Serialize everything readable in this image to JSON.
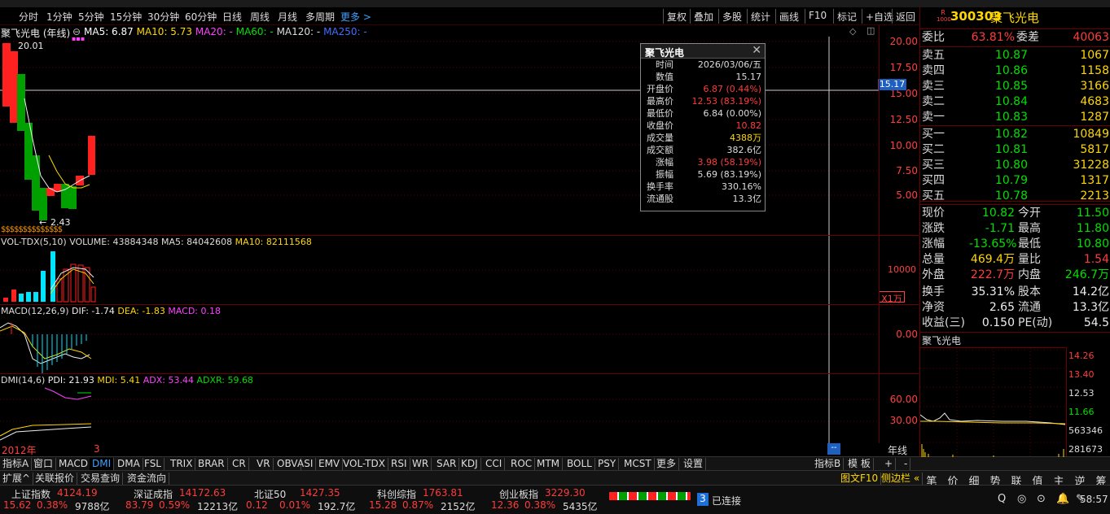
{
  "period_bar": {
    "items": [
      "分时",
      "1分钟",
      "5分钟",
      "15分钟",
      "30分钟",
      "60分钟",
      "日线",
      "周线",
      "月线",
      "多周期"
    ],
    "more": "更多 >",
    "tools": [
      "复权",
      "叠加",
      "多股",
      "统计",
      "画线",
      "F10",
      "标记",
      "+自选",
      "返回"
    ]
  },
  "main": {
    "stock_label": "聚飞光电 (年线)",
    "ma": [
      {
        "label": "MA5: 6.87",
        "color": "#ffffff"
      },
      {
        "label": "MA10: 5.73",
        "color": "#ffd700"
      },
      {
        "label": "MA20: -",
        "color": "#ff40ff"
      },
      {
        "label": "MA60: -",
        "color": "#00e000"
      },
      {
        "label": "MA120: -",
        "color": "#dddddd"
      },
      {
        "label": "MA250: -",
        "color": "#3f6fff"
      }
    ],
    "high_label": "20.01",
    "low_label": "2.43",
    "price_ticks": [
      "20.00",
      "17.50",
      "15.00",
      "12.50",
      "10.00",
      "7.50",
      "5.00"
    ],
    "cursor_value": "15.17"
  },
  "volume": {
    "label": "VOL-TDX(5,10)",
    "volume": "VOLUME: 43884348",
    "ma5": "MA5: 84042608",
    "ma10": "MA10: 82111568",
    "tick": "10000",
    "unit": "X1万"
  },
  "macd": {
    "label": "MACD(12,26,9)",
    "dif": "DIF: -1.74",
    "dea": "DEA: -1.83",
    "macd": "MACD: 0.18",
    "tick": "0.00"
  },
  "dmi": {
    "label": "DMI(14,6)",
    "pdi": "PDI: 21.93",
    "mdi": "MDI: 5.41",
    "adx": "ADX: 53.44",
    "adxr": "ADXR: 59.68",
    "ticks": [
      "60.00",
      "30.00"
    ]
  },
  "timeline": {
    "start": "2012年",
    "marker": "3",
    "period": "年线"
  },
  "tooltip": {
    "title": "聚飞光电",
    "rows": [
      {
        "k": "时间",
        "v": "2026/03/06/五",
        "c": "#dddddd"
      },
      {
        "k": "数值",
        "v": "15.17",
        "c": "#dddddd"
      },
      {
        "k": "开盘价",
        "v": "6.87 (0.44%)",
        "c": "#ff3c3c"
      },
      {
        "k": "最高价",
        "v": "12.53 (83.19%)",
        "c": "#ff3c3c"
      },
      {
        "k": "最低价",
        "v": "6.84 (0.00%)",
        "c": "#dddddd"
      },
      {
        "k": "收盘价",
        "v": "10.82",
        "c": "#ff3c3c"
      },
      {
        "k": "成交量",
        "v": "4388万",
        "c": "#ffd700"
      },
      {
        "k": "成交额",
        "v": "382.6亿",
        "c": "#dddddd"
      },
      {
        "k": "涨幅",
        "v": "3.98 (58.19%)",
        "c": "#ff3c3c"
      },
      {
        "k": "振幅",
        "v": "5.69 (83.19%)",
        "c": "#dddddd"
      },
      {
        "k": "换手率",
        "v": "330.16%",
        "c": "#dddddd"
      },
      {
        "k": "流通股",
        "v": "13.3亿",
        "c": "#dddddd"
      }
    ]
  },
  "indicator_tabs": [
    "指标A",
    "窗口",
    "MACD",
    "DMI",
    "DMA",
    "FSL",
    "TRIX",
    "BRAR",
    "CR",
    "VR",
    "OBV",
    "ASI",
    "EMV",
    "VOL-TDX",
    "RSI",
    "WR",
    "SAR",
    "KDJ",
    "CCI",
    "ROC",
    "MTM",
    "BOLL",
    "PSY",
    "MCST",
    "更多",
    "设置"
  ],
  "tabs_right": [
    "指标B",
    "模 板",
    "+",
    "-"
  ],
  "tabs2": [
    "扩展^",
    "关联报价",
    "交易查询",
    "资金流向"
  ],
  "tabs2_right": [
    "图文F10",
    "侧边栏 «"
  ],
  "side_nav": [
    "笔",
    "价",
    "细",
    "势",
    "联",
    "值",
    "主",
    "逆",
    "筹"
  ],
  "side": {
    "code": "300303",
    "name": "聚飞光电",
    "r_badge": "R",
    "num_badge": "1000",
    "weibi_k": "委比",
    "weibi_v": "63.81%",
    "weicha_k": "委差",
    "weicha_v": "40063",
    "sells": [
      {
        "k": "卖五",
        "p": "10.87",
        "v": "1067"
      },
      {
        "k": "卖四",
        "p": "10.86",
        "v": "1158"
      },
      {
        "k": "卖三",
        "p": "10.85",
        "v": "3166"
      },
      {
        "k": "卖二",
        "p": "10.84",
        "v": "4683"
      },
      {
        "k": "卖一",
        "p": "10.83",
        "v": "1287"
      }
    ],
    "buys": [
      {
        "k": "买一",
        "p": "10.82",
        "v": "10849"
      },
      {
        "k": "买二",
        "p": "10.81",
        "v": "5817"
      },
      {
        "k": "买三",
        "p": "10.80",
        "v": "31228"
      },
      {
        "k": "买四",
        "p": "10.79",
        "v": "1317"
      },
      {
        "k": "买五",
        "p": "10.78",
        "v": "2213"
      }
    ],
    "stats": [
      {
        "k1": "现价",
        "v1": "10.82",
        "c1": "#00e000",
        "k2": "今开",
        "v2": "11.50",
        "c2": "#00e000"
      },
      {
        "k1": "涨跌",
        "v1": "-1.71",
        "c1": "#00e000",
        "k2": "最高",
        "v2": "11.80",
        "c2": "#00e000"
      },
      {
        "k1": "涨幅",
        "v1": "-13.65%",
        "c1": "#00e000",
        "k2": "最低",
        "v2": "10.80",
        "c2": "#00e000"
      },
      {
        "k1": "总量",
        "v1": "469.4万",
        "c1": "#ffd700",
        "k2": "量比",
        "v2": "1.54",
        "c2": "#ff3c3c"
      },
      {
        "k1": "外盘",
        "v1": "222.7万",
        "c1": "#ff3c3c",
        "k2": "内盘",
        "v2": "246.7万",
        "c2": "#00e000"
      },
      {
        "k1": "换手",
        "v1": "35.31%",
        "c1": "#eeeeee",
        "k2": "股本",
        "v2": "14.2亿",
        "c2": "#eeeeee"
      },
      {
        "k1": "净资",
        "v1": "2.65",
        "c1": "#eeeeee",
        "k2": "流通",
        "v2": "13.3亿",
        "c2": "#eeeeee"
      },
      {
        "k1": "收益(三)",
        "v1": "0.150",
        "c1": "#eeeeee",
        "k2": "PE(动)",
        "v2": "54.5",
        "c2": "#eeeeee"
      }
    ],
    "mini_title": "聚飞光电",
    "mini_ticks": [
      "14.26",
      "13.40",
      "12.53",
      "11.66",
      "563346",
      "281673"
    ]
  },
  "status": {
    "indices": [
      {
        "name": "上证指数",
        "price": "4124.19",
        "chg": "15.62",
        "pct": "0.38%",
        "amt": "9788亿"
      },
      {
        "name": "深证成指",
        "price": "14172.63",
        "chg": "83.79",
        "pct": "0.59%",
        "amt": "12213亿"
      },
      {
        "name": "北证50",
        "price": "1427.35",
        "chg": "0.12",
        "pct": "0.01%",
        "amt": "192.7亿"
      },
      {
        "name": "科创综指",
        "price": "1763.81",
        "chg": "15.28",
        "pct": "0.87%",
        "amt": "2152亿"
      },
      {
        "name": "创业板指",
        "price": "3229.30",
        "chg": "12.36",
        "pct": "0.38%",
        "amt": "5435亿"
      }
    ],
    "conn_num": "3",
    "conn": "已连接",
    "time": "58:57"
  }
}
